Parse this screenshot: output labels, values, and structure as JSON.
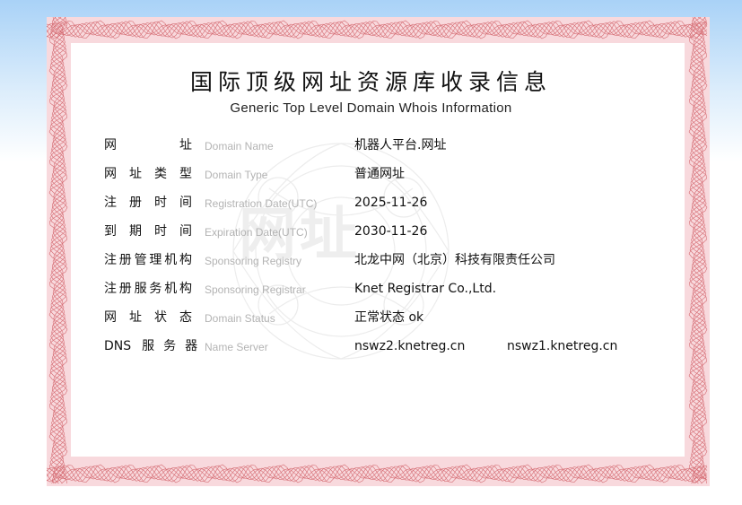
{
  "certificate": {
    "title": "国际顶级网址资源库收录信息",
    "subtitle": "Generic Top Level Domain Whois Information",
    "watermark": "网址"
  },
  "rows": [
    {
      "label_cn_chars": [
        "网",
        "址"
      ],
      "label_en": "Domain Name",
      "value": "机器人平台.网址"
    },
    {
      "label_cn_chars": [
        "网",
        "址",
        "类",
        "型"
      ],
      "label_en": "Domain Type",
      "value": "普通网址"
    },
    {
      "label_cn_chars": [
        "注",
        "册",
        "时",
        "间"
      ],
      "label_en": "Registration Date(UTC)",
      "value": "2025-11-26"
    },
    {
      "label_cn_chars": [
        "到",
        "期",
        "时",
        "间"
      ],
      "label_en": "Expiration Date(UTC)",
      "value": "2030-11-26"
    },
    {
      "label_cn_chars": [
        "注",
        "册",
        "管",
        "理",
        "机",
        "构"
      ],
      "label_en": "Sponsoring Registry",
      "value": "北龙中网（北京）科技有限责任公司"
    },
    {
      "label_cn_chars": [
        "注",
        "册",
        "服",
        "务",
        "机",
        "构"
      ],
      "label_en": "Sponsoring Registrar",
      "value": "Knet Registrar Co.,Ltd."
    },
    {
      "label_cn_chars": [
        "网",
        "址",
        "状",
        "态"
      ],
      "label_en": "Domain Status",
      "value": "正常状态 ok"
    }
  ],
  "dns_row": {
    "label_cn_chars": [
      "DNS",
      "服",
      "务",
      "器"
    ],
    "label_en": "Name Server",
    "value": "nswz2.knetreg.cn",
    "value2": "nswz1.knetreg.cn"
  },
  "colors": {
    "border_fill": "#f8d9dd",
    "guilloche": "#c9474f",
    "inner_background": "#ffffff"
  }
}
